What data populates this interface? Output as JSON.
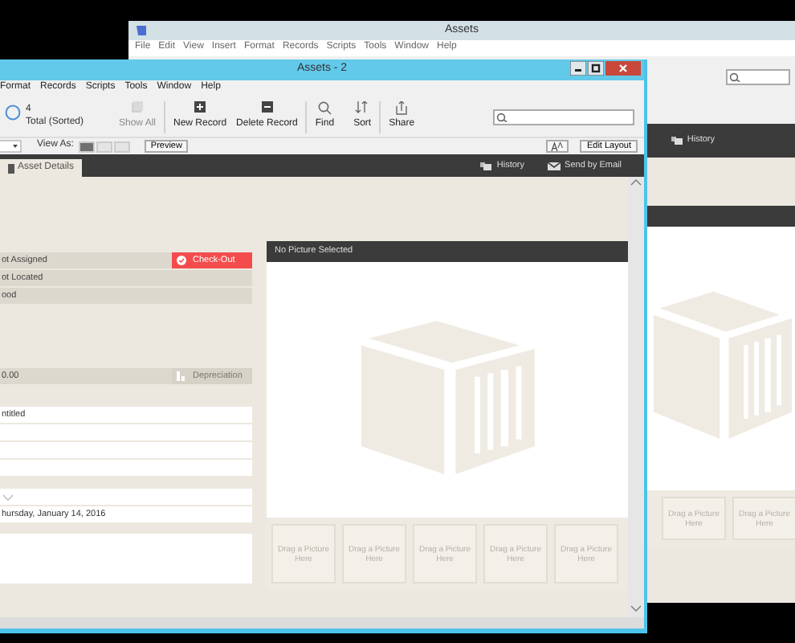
{
  "back_window": {
    "title": "Assets",
    "menu": [
      "File",
      "Edit",
      "View",
      "Insert",
      "Format",
      "Records",
      "Scripts",
      "Tools",
      "Window",
      "Help"
    ],
    "header_links": [
      {
        "label": "History",
        "kind": "history"
      }
    ],
    "thumbnails": [
      "Drag a Picture Here",
      "Drag a Picture Here"
    ]
  },
  "front_window": {
    "title": "Assets - 2",
    "menu": [
      "Format",
      "Records",
      "Scripts",
      "Tools",
      "Window",
      "Help"
    ],
    "record_count": "4",
    "record_status": "Total (Sorted)",
    "toolbar": [
      {
        "label": "Show All",
        "kind": "stack",
        "disabled": true
      },
      {
        "label": "New Record",
        "kind": "plus",
        "disabled": false
      },
      {
        "label": "Delete Record",
        "kind": "minus",
        "disabled": false
      },
      {
        "label": "Find",
        "kind": "search",
        "disabled": false
      },
      {
        "label": "Sort",
        "kind": "sort",
        "disabled": false
      },
      {
        "label": "Share",
        "kind": "share",
        "disabled": false
      }
    ],
    "view_as": {
      "label": "View As:",
      "modes": [
        {
          "selected": true
        },
        {
          "selected": false
        },
        {
          "selected": false
        }
      ]
    },
    "preview_button": "Preview",
    "edit_layout_button": "Edit Layout",
    "tab": {
      "label": "Asset Details",
      "selected": true
    },
    "header_links": [
      {
        "label": "History",
        "kind": "history"
      },
      {
        "label": "Send by Email",
        "kind": "email"
      }
    ],
    "status_fields": [
      {
        "value": "ot Assigned",
        "action": {
          "label": "Check-Out",
          "disabled": false
        }
      },
      {
        "value": "ot Located"
      },
      {
        "value": "ood"
      }
    ],
    "cost_field": {
      "value": "0.00",
      "action": {
        "label": "Depreciation",
        "disabled": true
      }
    },
    "fields": [
      {
        "kind": "text",
        "value": "ntitled"
      },
      {
        "kind": "text"
      },
      {
        "kind": "text"
      },
      {
        "kind": "text"
      },
      {
        "kind": "dropdown"
      },
      {
        "kind": "text",
        "value": "hursday, January 14, 2016"
      },
      {
        "kind": "area"
      }
    ],
    "picture_panel": {
      "title": "No Picture Selected",
      "thumbnails": [
        "Drag a Picture Here",
        "Drag a Picture Here",
        "Drag a Picture Here",
        "Drag a Picture Here",
        "Drag a Picture Here"
      ]
    }
  }
}
